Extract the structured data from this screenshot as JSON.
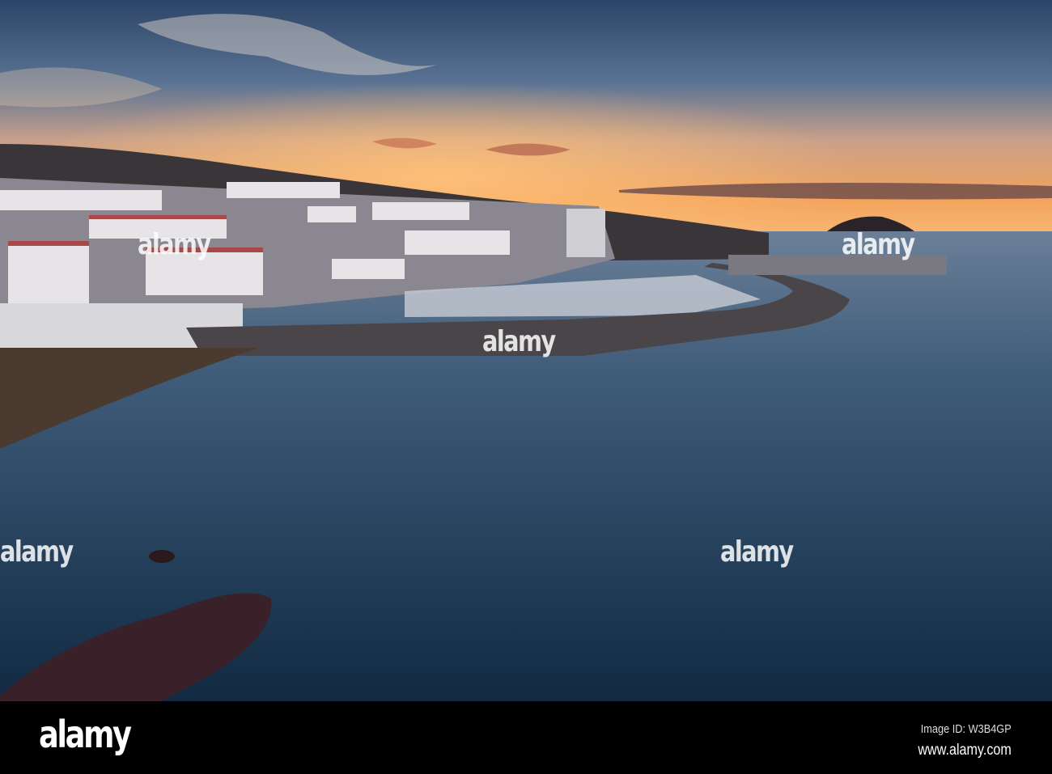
{
  "watermark": {
    "text": "alamy"
  },
  "footer": {
    "logo": "alamy",
    "image_id": "Image ID: W3B4GP",
    "website": "www.alamy.com"
  },
  "colors": {
    "sky_top": "#2f4a6e",
    "horizon": "#f0a060",
    "sea": "#1f3a55",
    "land": "#2a2a30"
  }
}
